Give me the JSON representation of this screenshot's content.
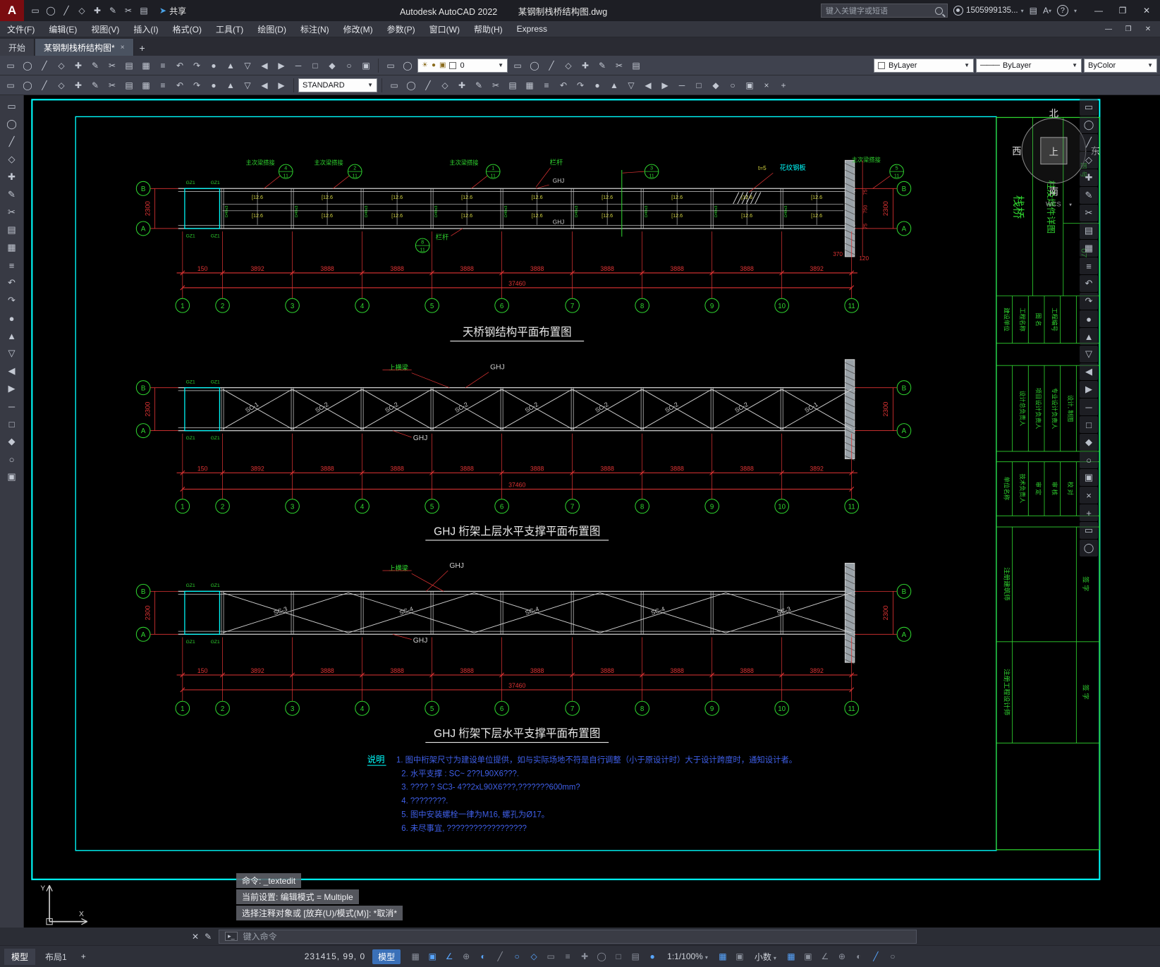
{
  "titlebar": {
    "logo": "A",
    "qat_icons": [
      "qnew",
      "open",
      "save",
      "save-as",
      "plot",
      "undo",
      "redo",
      "customize-qat"
    ],
    "share": "共享",
    "app": "Autodesk AutoCAD 2022",
    "doc": "某钢制栈桥结构图.dwg",
    "search_placeholder": "键入关键字或短语",
    "account": "1505999135...",
    "window": {
      "min": "—",
      "max": "❐",
      "close": "✕"
    }
  },
  "menubar": {
    "items": [
      "文件(F)",
      "编辑(E)",
      "视图(V)",
      "插入(I)",
      "格式(O)",
      "工具(T)",
      "绘图(D)",
      "标注(N)",
      "修改(M)",
      "参数(P)",
      "窗口(W)",
      "帮助(H)",
      "Express"
    ]
  },
  "filetabs": {
    "start": "开始",
    "doc": "某钢制栈桥结构图*",
    "close": "×",
    "add": "+"
  },
  "toolbars": {
    "row1_left_icons": [
      "qnew",
      "open",
      "save",
      "save-as",
      "plot",
      "plot-preview",
      "publish",
      "cut",
      "copy",
      "paste",
      "match-properties",
      "block-editor",
      "undo",
      "redo",
      "pan-realtime",
      "zoom-realtime",
      "zoom-window",
      "zoom-previous",
      "properties",
      "design-center",
      "tool-palettes",
      "sheet-set-manager"
    ],
    "layer_tools": [
      "layer-properties",
      "layer-states"
    ],
    "layer_value": "0",
    "row1_mid_icons": [
      "make-object-layer-current",
      "layer-previous",
      "layer-walk",
      "layer-freeze",
      "layer-off",
      "layer-lock",
      "layer-unlock",
      "layer-isolate"
    ],
    "color": "ByLayer",
    "linetype": "ByLayer",
    "plotstyle": "ByColor",
    "row2_left_icons": [
      "workspace-switch",
      "text-style",
      "dimension-style",
      "table-style",
      "point-style",
      "multileader-style",
      "plot-style",
      "draw-order-front",
      "draw-order-back",
      "group",
      "ungroup",
      "measure",
      "quick-calc",
      "field",
      "update-field",
      "data-link",
      "oleref"
    ],
    "style": "STANDARD",
    "row2_right_icons": [
      "move",
      "copy-obj",
      "stretch",
      "rotate",
      "mirror",
      "scale",
      "trim",
      "extend",
      "break",
      "join",
      "chamfer",
      "fillet",
      "array",
      "offset",
      "erase",
      "explode",
      "dim-linear",
      "dim-aligned",
      "dim-angular",
      "dim-radius",
      "dim-diameter",
      "leader",
      "text",
      "mtext"
    ]
  },
  "left_palette": {
    "icons": [
      "line",
      "construction-line",
      "polyline",
      "polygon",
      "rectangle",
      "arc",
      "circle",
      "revision-cloud",
      "spline",
      "ellipse",
      "ellipse-arc",
      "insert-block",
      "make-block",
      "point",
      "hatch",
      "gradient",
      "region",
      "table",
      "multiline-text",
      "add-selected",
      "text-style-a",
      "point-marker"
    ]
  },
  "right_palette": {
    "icons": [
      "erase",
      "copy",
      "mirror",
      "offset",
      "array",
      "move",
      "rotate",
      "scale",
      "stretch",
      "lengthen",
      "trim",
      "extend",
      "break-at-point",
      "break",
      "join",
      "chamfer",
      "fillet",
      "blend-curves",
      "explode",
      "edit-polyline",
      "edit-spline",
      "edit-hatch",
      "align",
      "draw-order",
      "isolate",
      "hide"
    ]
  },
  "canvas": {
    "compass": {
      "north": "北",
      "south": "南",
      "west": "西",
      "east": "东",
      "cube_top": "上",
      "wcs": "WCS",
      "wcs_caret": "▾"
    },
    "grid_labels": [
      "1",
      "2",
      "3",
      "4",
      "5",
      "6",
      "7",
      "8",
      "9",
      "10",
      "11"
    ],
    "row_labels": [
      "B",
      "A"
    ],
    "side_dim": "2300",
    "dim_first": "150",
    "dim_spans": [
      "3892",
      "3888",
      "3888",
      "3888",
      "3888",
      "3888",
      "3888",
      "3888",
      "3892"
    ],
    "dim_total": "37460",
    "views": {
      "plan": {
        "title": "天桥钢结构平面布置图",
        "channel": "[12.6",
        "post": "D40x3",
        "ghj": "GHJ",
        "column": "GZ1",
        "railing": "栏杆",
        "splice": "主次梁搭接",
        "plate_t": "t=5",
        "plate": "花纹钢板",
        "bubbles": [
          [
            "4",
            "11"
          ],
          [
            "2",
            "11"
          ],
          [
            "1",
            "11"
          ],
          [
            "3",
            "11"
          ],
          [
            "5",
            "11"
          ],
          [
            "8",
            "11"
          ]
        ],
        "right_dims": [
          "75",
          "750",
          "75"
        ],
        "end_dims": [
          "370",
          "120"
        ]
      },
      "upper": {
        "title": "GHJ 桁架上层水平支撑平面布置图",
        "braces": [
          "SC-1",
          "SC-2",
          "SC-2",
          "SC-2",
          "SC-2",
          "SC-2",
          "SC-2",
          "SC-2",
          "SC-1"
        ],
        "beam": "上横梁",
        "ghj": "GHJ",
        "column": "GZ1"
      },
      "lower": {
        "title": "GHJ 桁架下层水平支撑平面布置图",
        "braces": [
          "SC-3",
          "SC-4",
          "SC-4",
          "SC-4",
          "SC-3"
        ],
        "beam": "上横梁",
        "ghj": "GHJ",
        "column": "GZ1"
      }
    },
    "notes": {
      "heading": "说明",
      "items": [
        "1. 图中桁架尺寸为建设单位提供，如与实际场地不符是自行调整（小于原设计时）大于设计跨度时，通知设计者。",
        "2. 水平支撑  : SC~   2??L90X6???.",
        "3. ????  ? SC3-   4??2xL90X6???,???????600mm?",
        "4. ????????.",
        "5. 图中安装螺栓一律为M16, 螺孔为Ø17。",
        "6. 未尽事宜,  ??????????????????"
      ]
    },
    "titleblock": {
      "project": "栈桥",
      "sheet": "柱及焊件详图",
      "no_label": "图 号",
      "no": "07",
      "row1": [
        "建设单位",
        "工程名称",
        "图  名",
        "工程编号"
      ],
      "row2": [
        "设计总负责人",
        "项目设计负责人",
        "专业设计负责人",
        "设计, 制图"
      ],
      "row3": [
        "单位名称",
        "技术负责人",
        "审 定",
        "审 核",
        "校 对"
      ],
      "row4": [
        "注册建筑师",
        "签 字"
      ],
      "row5": [
        "注册工程设计师",
        "签 字"
      ]
    },
    "ucs": {
      "x": "X",
      "y": "Y"
    }
  },
  "command": {
    "history": [
      "命令: _textedit",
      "当前设置: 编辑模式 = Multiple",
      "选择注释对象或 [放弃(U)/模式(M)]: *取消*"
    ],
    "prompt": "键入命令"
  },
  "statusbar": {
    "model_tab": "模型",
    "layout_tab": "布局1",
    "add_tab": "+",
    "coords": "231415, 99, 0",
    "model_badge": "模型",
    "icons_a": [
      [
        "infer-constraints",
        0
      ],
      [
        "snap-mode",
        1
      ],
      [
        "grid-display",
        1
      ],
      [
        "ortho-mode",
        0
      ],
      [
        "polar-tracking",
        1
      ],
      [
        "isometric-drafting",
        0
      ],
      [
        "object-snap-tracking",
        1
      ],
      [
        "object-snap",
        1
      ],
      [
        "lineweight",
        0
      ],
      [
        "transparency",
        0
      ],
      [
        "selection-cycling",
        0
      ],
      [
        "3d-object-snap",
        0
      ],
      [
        "dynamic-ucs",
        0
      ],
      [
        "selection-filtering",
        0
      ],
      [
        "gizmo",
        1
      ]
    ],
    "scale": "1:1/100%",
    "icons_b": [
      [
        "annotation-visibility",
        1
      ],
      [
        "autoscale",
        0
      ]
    ],
    "units": "小数",
    "icons_c": [
      [
        "workspace-switching",
        1
      ],
      [
        "annotation-monitor",
        0
      ],
      [
        "quick-properties",
        0
      ],
      [
        "lock-ui",
        0
      ],
      [
        "isolate-objects",
        0
      ],
      [
        "graphics-performance",
        1
      ],
      [
        "clean-screen",
        0
      ]
    ],
    "scale_caret": "▾",
    "units_caret": "▾"
  }
}
